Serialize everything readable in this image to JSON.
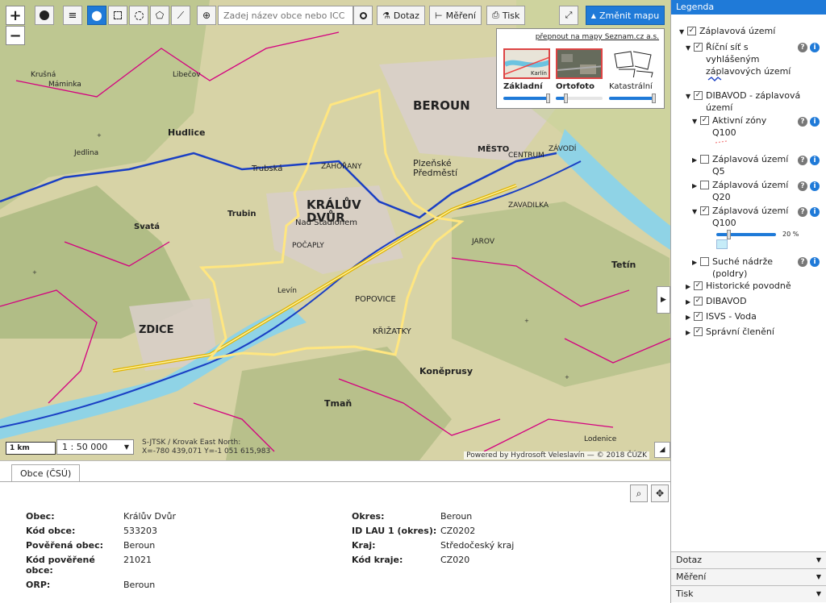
{
  "toolbar": {
    "search_placeholder": "Zadej název obce nebo ICC",
    "query_label": "Dotaz",
    "measure_label": "Měření",
    "print_label": "Tisk",
    "change_map_label": "Změnit mapu"
  },
  "map_switch": {
    "link": "přepnout na mapy Seznam.cz a.s.",
    "basic": "Základní",
    "ortho": "Ortofoto",
    "cadastral": "Katastrální",
    "basic_thumb": "Karlín"
  },
  "map_labels": {
    "beroun": "BEROUN",
    "kraluv_dvur": "KRÁLŮV DVŮR",
    "nad_stadlonem": "Nad Stadlonem",
    "zdice": "ZDICE",
    "hudlice": "Hudlice",
    "trubin": "Trubin",
    "svata": "Svatá",
    "trubska": "Trubská",
    "popovice": "POPOVICE",
    "krizatky": "KŘIŽATKY",
    "koneprusy": "Koněprusy",
    "tman": "Tmaň",
    "tetin": "Tetín",
    "mesto": "MĚSTO",
    "centrum": "CENTRUM",
    "zavodi": "ZÁVODÍ",
    "zavadilka": "ZAVADILKA",
    "plzenske": "Plzeňské",
    "predmesti": "Předměstí",
    "pocaply": "POČAPLY",
    "jarov": "JAROV",
    "zahorany": "ZAHOŘANY",
    "krusna": "Krušná",
    "mamicka": "Máminka",
    "jedlina": "Jedlina",
    "libecov": "Libečov",
    "levin": "Levín",
    "lodenice": "Lodenice"
  },
  "scale": {
    "bar_label": "1 km",
    "select_value": "1 : 50 000"
  },
  "coords": {
    "line1": "S-JTSK / Krovak East North:",
    "line2": "X=-780 439,071 Y=-1 051 615,983"
  },
  "attribution": "Powered by Hydrosoft Veleslavín — © 2018 ČÚZK",
  "bottom": {
    "tab": "Obce (ČSÚ)",
    "left": [
      {
        "k": "Obec:",
        "v": "Králův Dvůr"
      },
      {
        "k": "Kód obce:",
        "v": "533203"
      },
      {
        "k": "Pověřená obec:",
        "v": "Beroun"
      },
      {
        "k": "Kód pověřené obce:",
        "v": "21021"
      },
      {
        "k": "ORP:",
        "v": "Beroun"
      }
    ],
    "right": [
      {
        "k": "Okres:",
        "v": "Beroun"
      },
      {
        "k": "ID LAU 1 (okres):",
        "v": "CZ0202"
      },
      {
        "k": "Kraj:",
        "v": "Středočeský kraj"
      },
      {
        "k": "Kód kraje:",
        "v": "CZ020"
      }
    ]
  },
  "legend": {
    "title": "Legenda",
    "zaplavova": "Záplavová území",
    "ricni_sit": "Říční síť s vyhlášeným záplavových území",
    "dibavod_zap": "DIBAVOD - záplavová území",
    "aktivni": "Aktivní zóny Q100",
    "q5": "Záplavová území Q5",
    "q20": "Záplavová území Q20",
    "q100": "Záplavová území Q100",
    "opacity": "20 %",
    "opacity_value": 0.2,
    "suche": "Suché nádrže (poldry)",
    "historicke": "Historické povodně",
    "dibavod": "DIBAVOD",
    "isvs": "ISVS - Voda",
    "spravni": "Správní členění"
  },
  "accordion": {
    "dotaz": "Dotaz",
    "mereni": "Měření",
    "tisk": "Tisk"
  },
  "colors": {
    "accent": "#1f7ad8",
    "boundary": "#ffe680",
    "river": "#1a3fc4",
    "municipal": "#d4007f"
  }
}
